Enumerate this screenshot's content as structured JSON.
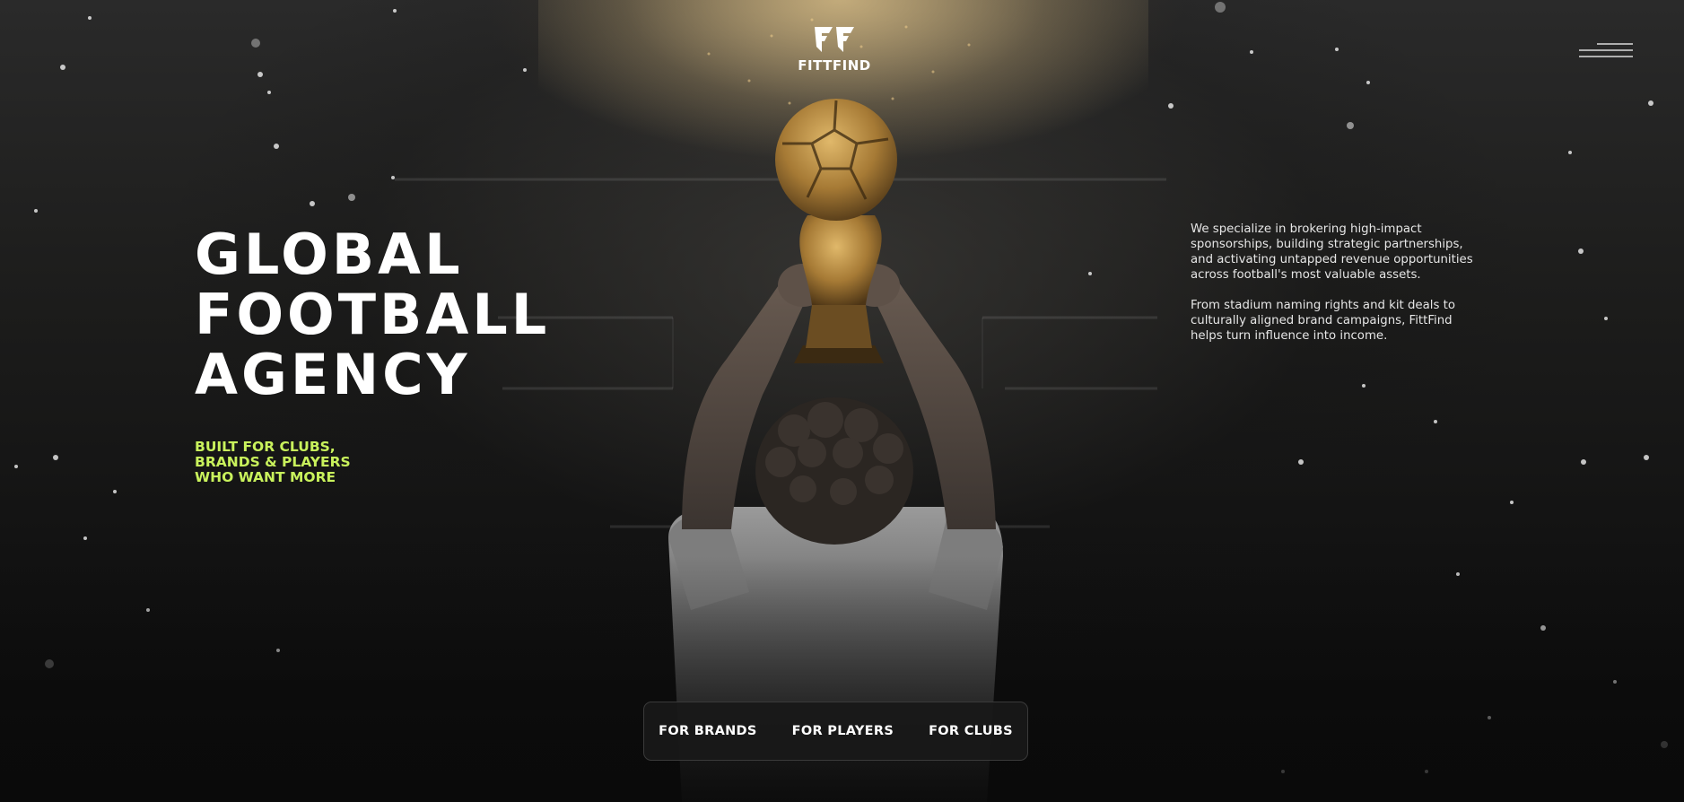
{
  "brand": {
    "name": "FITTFIND",
    "logo_icon": "ff-monogram-icon"
  },
  "header": {
    "menu_icon": "hamburger-menu-icon"
  },
  "hero": {
    "title_lines": [
      "GLOBAL",
      "FOOTBALL",
      "AGENCY"
    ],
    "tagline_lines": [
      "BUILT FOR CLUBS,",
      "BRANDS & PLAYERS",
      "WHO WANT MORE"
    ],
    "image": "player-raising-trophy-illustration"
  },
  "intro": {
    "paragraphs": [
      "We specialize in brokering high-impact sponsorships, building strategic partnerships, and activating untapped revenue opportunities across football's most valuable assets.",
      "From stadium naming rights and kit deals to culturally aligned brand campaigns, FittFind helps turn influence into income."
    ]
  },
  "audience_nav": {
    "items": [
      {
        "label": "FOR BRANDS"
      },
      {
        "label": "FOR PLAYERS"
      },
      {
        "label": "FOR CLUBS"
      }
    ]
  },
  "colors": {
    "accent": "#c9f25c",
    "background": "#121212",
    "text": "#ffffff"
  }
}
